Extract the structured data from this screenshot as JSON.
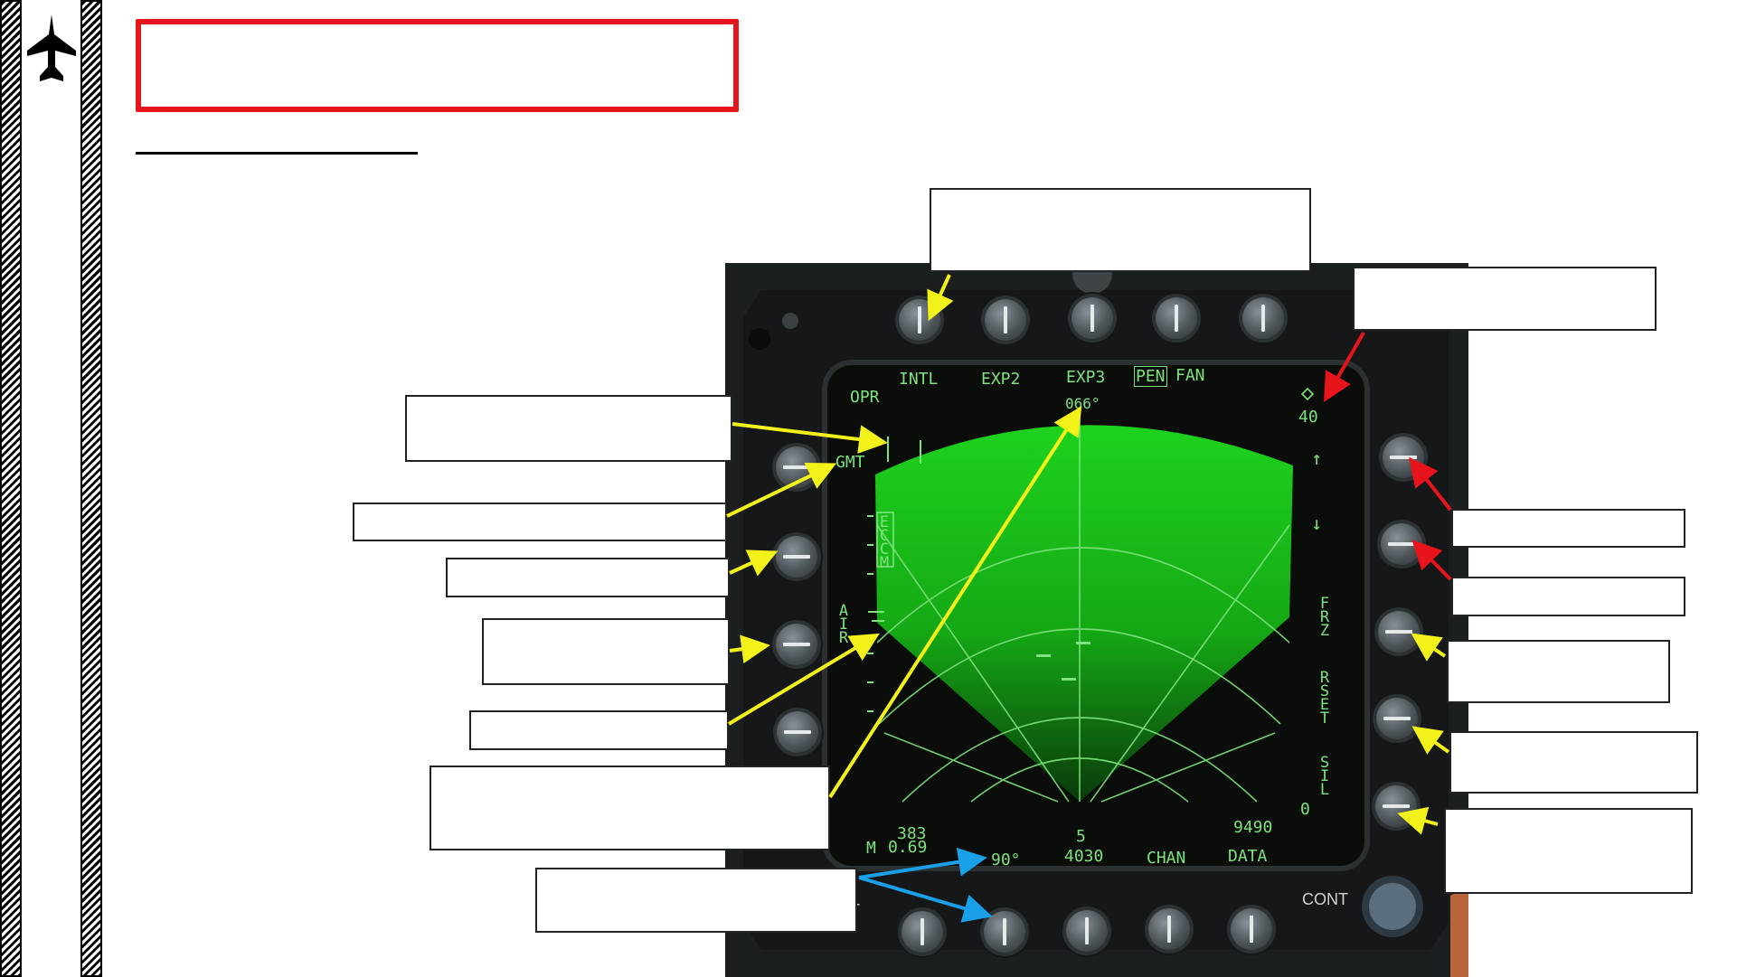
{
  "mfd": {
    "top_labels": [
      "INTL",
      "EXP2",
      "EXP3",
      "PEN",
      "FAN"
    ],
    "opr": "OPR",
    "heading": "066°",
    "range_value": "40",
    "up_arrow": "↑",
    "down_arrow": "↓",
    "left_labels": {
      "gmt": "GMT",
      "eccm": "ECCM",
      "air": "AIR"
    },
    "right_labels": {
      "frz": "FRZ",
      "rset": "RSET",
      "sil": "SIL",
      "zero": "0"
    },
    "bottom": {
      "m": "M",
      "speed_top": "383",
      "mach": "0.69",
      "azimuth": "90°",
      "center_top": "5",
      "center_bottom": "4030",
      "chan": "CHAN",
      "data_top": "9490",
      "data": "DATA",
      "cont": "CONT",
      "partial_t": "T"
    }
  },
  "colors": {
    "highlight_red": "#e8141b",
    "arrow_yellow": "#f2f21a",
    "arrow_red": "#e8141b",
    "arrow_blue": "#1aa0e8",
    "radar_green": "#19c219",
    "symbology_green": "#7ee27e"
  },
  "icons": {
    "sidebar": "fighter-jet-icon"
  }
}
